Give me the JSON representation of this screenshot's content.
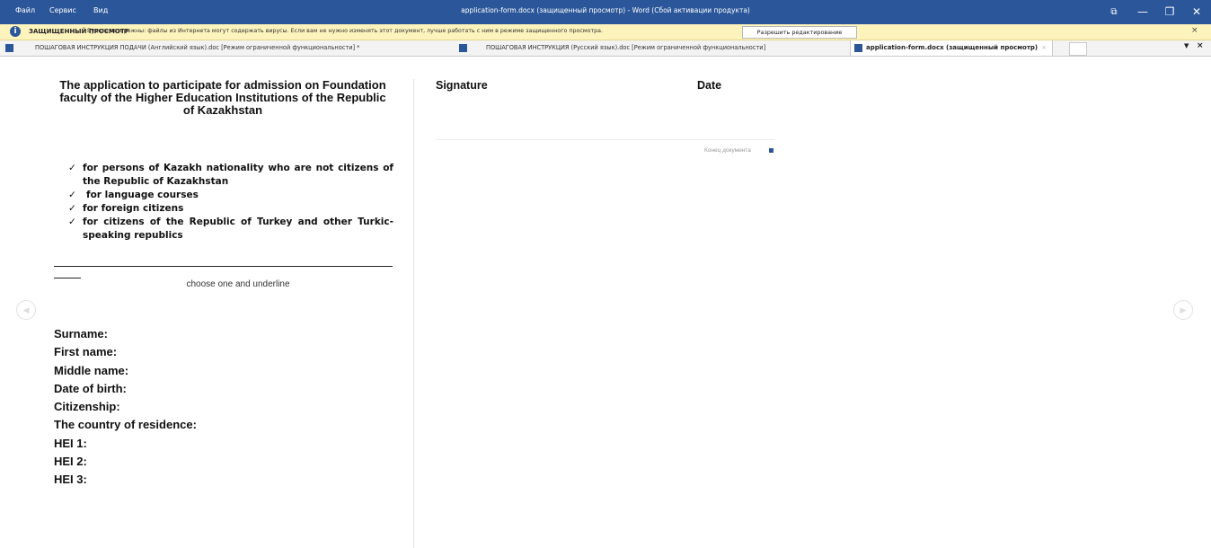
{
  "titlebar": {
    "menu": [
      "Файл",
      "Сервис",
      "Вид"
    ],
    "title": "application-form.docx (защищенный просмотр) - Word (Сбой активации продукта)",
    "buttons": {
      "restore": "⧉",
      "minimize": "—",
      "maximize": "❐",
      "close": "✕"
    }
  },
  "protected_view": {
    "label": "ЗАЩИЩЕННЫЙ ПРОСМОТР",
    "message": "Будьте осторожны: файлы из Интернета могут содержать вирусы. Если вам не нужно изменять этот документ, лучше работать с ним в режиме защищенного просмотра.",
    "enable_button": "Разрешить редактирование",
    "close": "×"
  },
  "tabs": [
    {
      "label": "ПОШАГОВАЯ ИНСТРУКЦИЯ ПОДАЧИ (Английский язык).doc [Режим ограниченной функциональности] *"
    },
    {
      "label": "ПОШАГОВАЯ ИНСТРУКЦИЯ (Русский язык).doc [Режим ограниченной функциональности]"
    },
    {
      "label": "application-form.docx (защищенный просмотр)",
      "close": "×"
    }
  ],
  "tabbar_controls": {
    "dropdown": "▼",
    "close": "×"
  },
  "nav": {
    "prev": "◀",
    "next": "▶"
  },
  "document": {
    "title": "The application to participate for admission on Foundation faculty of the Higher Education Institutions of the Republic of Kazakhstan",
    "checkmark": "✓",
    "options": [
      "for persons of Kazakh nationality who are not citizens of the Republic of Kazakhstan",
      "for language courses",
      "for foreign citizens",
      "for citizens of the Republic of Turkey and other Turkic-speaking republics"
    ],
    "choose_note": "choose one and underline",
    "fields": [
      "Surname:",
      "First name:",
      "Middle name:",
      "Date of birth:",
      "Citizenship:",
      "The country of residence:",
      "HEI 1:",
      "HEI 2:",
      "HEI 3:"
    ],
    "signature_label": "Signature",
    "date_label": "Date",
    "end_of_document": "Конец документа"
  }
}
